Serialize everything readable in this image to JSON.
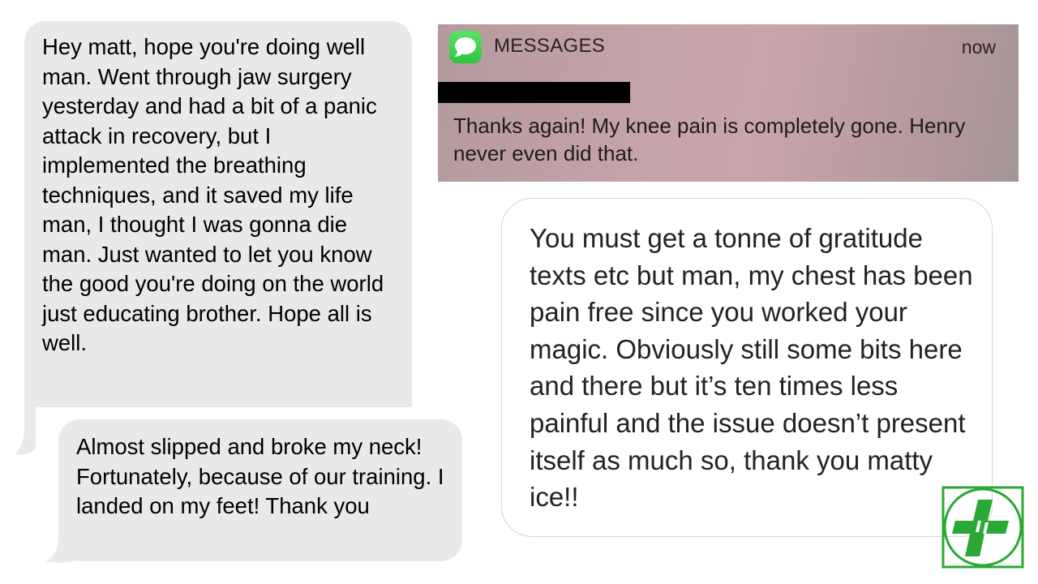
{
  "messages": {
    "gray_1": "Hey matt, hope you're doing well man. Went through jaw surgery yesterday and had a bit of a panic attack in recovery, but I implemented the breathing techniques, and it saved my life man, I thought I was gonna die man. Just wanted to let you know the good you're doing on the world just educating brother. Hope all is well.",
    "gray_2": "Almost slipped and broke my neck! Fortunately, because of our training. I landed on my feet! Thank you",
    "white_1": "You must get a tonne of gratitude texts etc but man, my chest has been pain free since you worked your magic. Obviously still some bits here and there but it’s ten times less painful and the issue doesn’t present itself as much so, thank you matty ice!!"
  },
  "notification": {
    "app_name": "MESSAGES",
    "time": "now",
    "body": "Thanks again! My knee pain is completely gone. Henry never even did that.",
    "icon": "messages-app-icon"
  },
  "logo": {
    "icon": "green-cross-logo",
    "color": "#2aa836"
  },
  "colors": {
    "gray_bubble": "#e9e9eb",
    "notification_bg": "#c4a3a9",
    "messages_green": "#34c759"
  }
}
